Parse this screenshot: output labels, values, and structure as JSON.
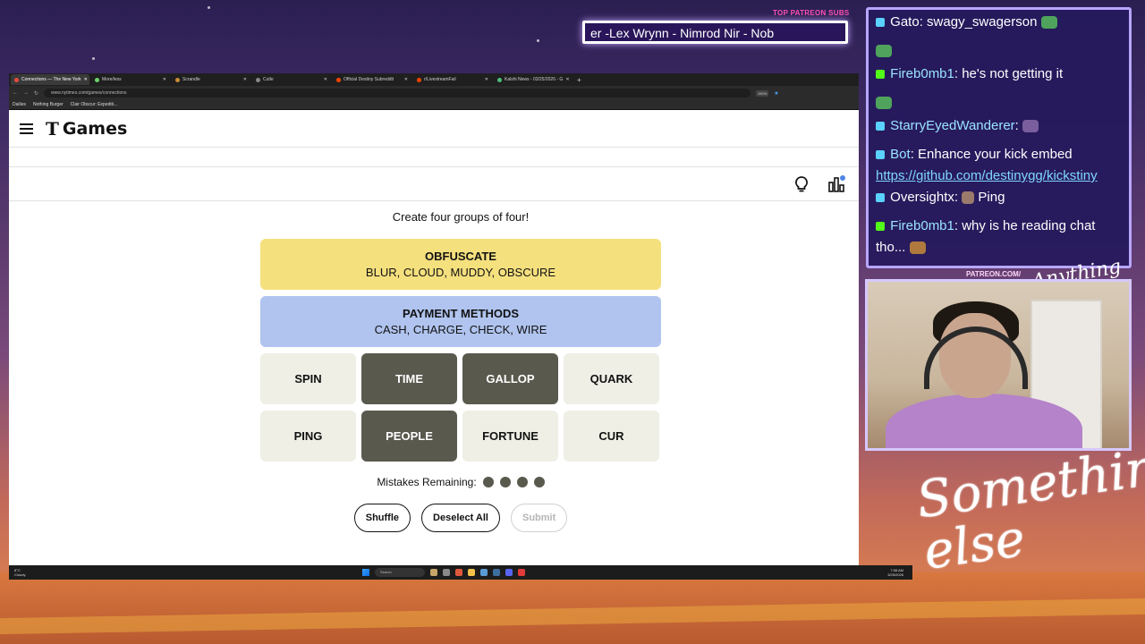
{
  "overlay": {
    "subs_title": "TOP PATREON SUBS",
    "subs_ticker": "er -Lex Wrynn - Nimrod Nir - Nob",
    "patreon_label": "PATREON.COM/",
    "script_top": "Anything else",
    "script_main": "Something else"
  },
  "browser": {
    "tabs": [
      {
        "label": "Connections — The New York",
        "active": true
      },
      {
        "label": "More/less",
        "active": false
      },
      {
        "label": "Scrandle",
        "active": false
      },
      {
        "label": "Cutle",
        "active": false
      },
      {
        "label": "Official Destiny Subreddit",
        "active": false
      },
      {
        "label": "r/LivestreamFail",
        "active": false
      },
      {
        "label": "Kalshi News - 03/25/2026 - G",
        "active": false
      }
    ],
    "url": "www.nytimes.com/games/connections",
    "zoom": "150%",
    "bookmarks": [
      "Dailies",
      "Nothing Burger",
      "Clair Obscur: Expediti..."
    ]
  },
  "site": {
    "logo_t": "T",
    "logo_games": "Games"
  },
  "game": {
    "prompt": "Create four groups of four!",
    "solved": [
      {
        "title": "OBFUSCATE",
        "words": "BLUR, CLOUD, MUDDY, OBSCURE",
        "color": "#f5e07e"
      },
      {
        "title": "PAYMENT METHODS",
        "words": "CASH, CHARGE, CHECK, WIRE",
        "color": "#b0c4ef"
      }
    ],
    "tiles": [
      {
        "word": "SPIN",
        "selected": false
      },
      {
        "word": "TIME",
        "selected": true
      },
      {
        "word": "GALLOP",
        "selected": true
      },
      {
        "word": "QUARK",
        "selected": false
      },
      {
        "word": "PING",
        "selected": false
      },
      {
        "word": "PEOPLE",
        "selected": true
      },
      {
        "word": "FORTUNE",
        "selected": false
      },
      {
        "word": "CUR",
        "selected": false
      }
    ],
    "mistakes_label": "Mistakes Remaining:",
    "mistakes_remaining": 4,
    "shuffle_label": "Shuffle",
    "deselect_label": "Deselect All",
    "submit_label": "Submit"
  },
  "taskbar": {
    "weather_temp": "8°C",
    "weather_desc": "Cloudy",
    "search_label": "Search",
    "time": "7:58 AM",
    "date": "3/25/2026"
  },
  "chat": {
    "messages": [
      {
        "user": "Gato",
        "text": "swagy_swagerson",
        "badge_color": "#5ad1ff"
      },
      {
        "user": "",
        "text": "",
        "badge_color": ""
      },
      {
        "user": "Fireb0mb1",
        "text": "he's not getting it",
        "badge_color": "#53fc18"
      },
      {
        "user": "",
        "text": "",
        "badge_color": ""
      },
      {
        "user": "StarryEyedWanderer",
        "text": "",
        "badge_color": "#5ad1ff"
      },
      {
        "user": "Bot",
        "text": "Enhance your kick embed",
        "badge_color": "#5ad1ff"
      },
      {
        "user": "",
        "text": "https://github.com/destinygg/kickstiny",
        "badge_color": ""
      },
      {
        "user": "Oversightx",
        "text": "Ping",
        "badge_color": "#5ad1ff"
      },
      {
        "user": "Fireb0mb1",
        "text": "why is he reading chat tho...",
        "badge_color": "#53fc18"
      }
    ]
  }
}
